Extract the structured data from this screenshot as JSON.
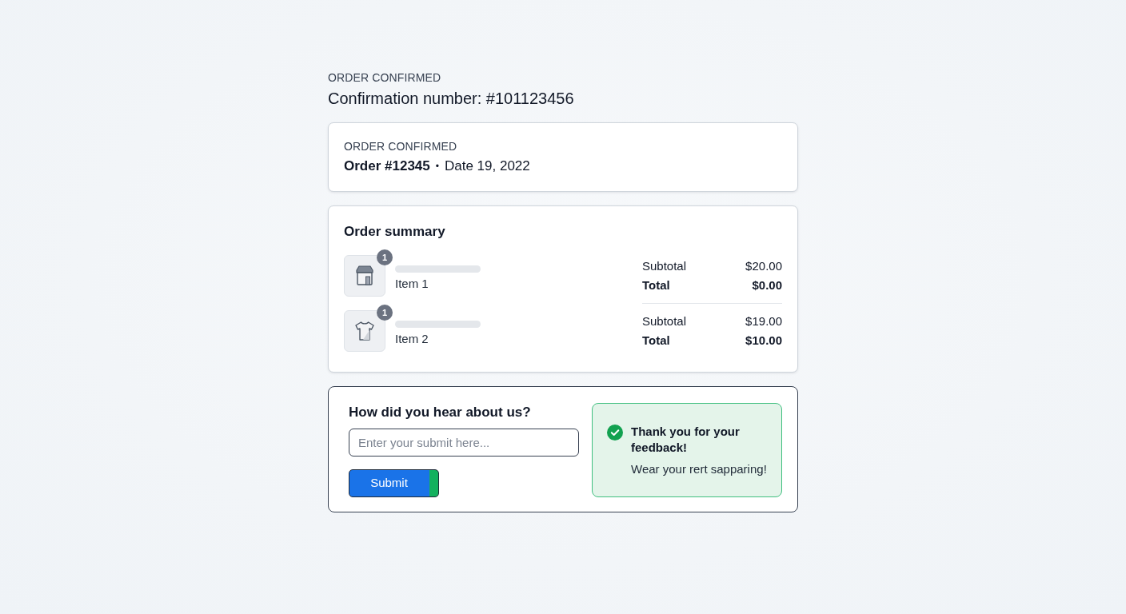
{
  "header": {
    "eyebrow": "ORDER CONFIRMED",
    "title": "Confirmation number: #101123456"
  },
  "order_card": {
    "eyebrow": "ORDER CONFIRMED",
    "order": "Order #12345",
    "separator": "•",
    "date": "Date 19, 2022"
  },
  "summary": {
    "title": "Order summary",
    "items": [
      {
        "kind": "store",
        "quantity": "1",
        "name": "Item 1",
        "subtotal_label": "Subtotal",
        "subtotal": "$20.00",
        "total_label": "Total",
        "total": "$0.00"
      },
      {
        "kind": "shirt",
        "quantity": "1",
        "name": "Item 2",
        "subtotal_label": "Subtotal",
        "subtotal": "$19.00",
        "total_label": "Total",
        "total": "$10.00"
      }
    ]
  },
  "feedback": {
    "question": "How did you hear about us?",
    "input": {
      "placeholder": "Enter your submit here..."
    },
    "button": "Submit",
    "alert": {
      "title": "Thank you for your feedback!",
      "message": "Wear your rert sapparing!"
    }
  }
}
